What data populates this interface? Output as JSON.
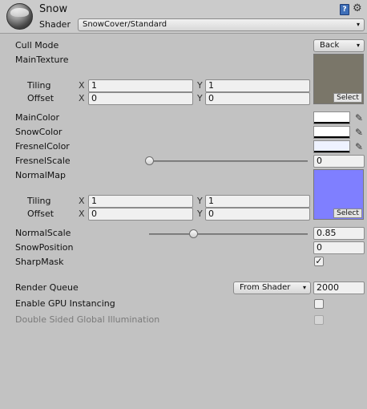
{
  "header": {
    "title": "Snow",
    "shader_label": "Shader",
    "shader_value": "SnowCover/Standard"
  },
  "cull_mode": {
    "label": "Cull Mode",
    "value": "Back"
  },
  "main_texture": {
    "label": "MainTexture",
    "select_label": "Select",
    "tiling_label": "Tiling",
    "tiling_x": "1",
    "tiling_y": "1",
    "offset_label": "Offset",
    "offset_x": "0",
    "offset_y": "0"
  },
  "colors": {
    "main": "MainColor",
    "snow": "SnowColor",
    "fresnel": "FresnelColor"
  },
  "fresnel_scale": {
    "label": "FresnelScale",
    "value": "0",
    "level": 0.0
  },
  "normal_map": {
    "label": "NormalMap",
    "select_label": "Select",
    "tiling_label": "Tiling",
    "tiling_x": "1",
    "tiling_y": "1",
    "offset_label": "Offset",
    "offset_x": "0",
    "offset_y": "0"
  },
  "normal_scale": {
    "label": "NormalScale",
    "value": "0.85",
    "level": 0.28
  },
  "snow_position": {
    "label": "SnowPosition",
    "value": "0"
  },
  "sharp_mask": {
    "label": "SharpMask",
    "checked": true
  },
  "render_queue": {
    "label": "Render Queue",
    "source": "From Shader",
    "value": "2000"
  },
  "gpu_instancing": {
    "label": "Enable GPU Instancing",
    "checked": false
  },
  "double_sided_gi": {
    "label": "Double Sided Global Illumination",
    "checked": false
  },
  "axis": {
    "x": "X",
    "y": "Y"
  },
  "icons": {
    "dropdown": "▾",
    "picker": "✎",
    "check": "✓",
    "gear": "⚙",
    "help": "?"
  }
}
